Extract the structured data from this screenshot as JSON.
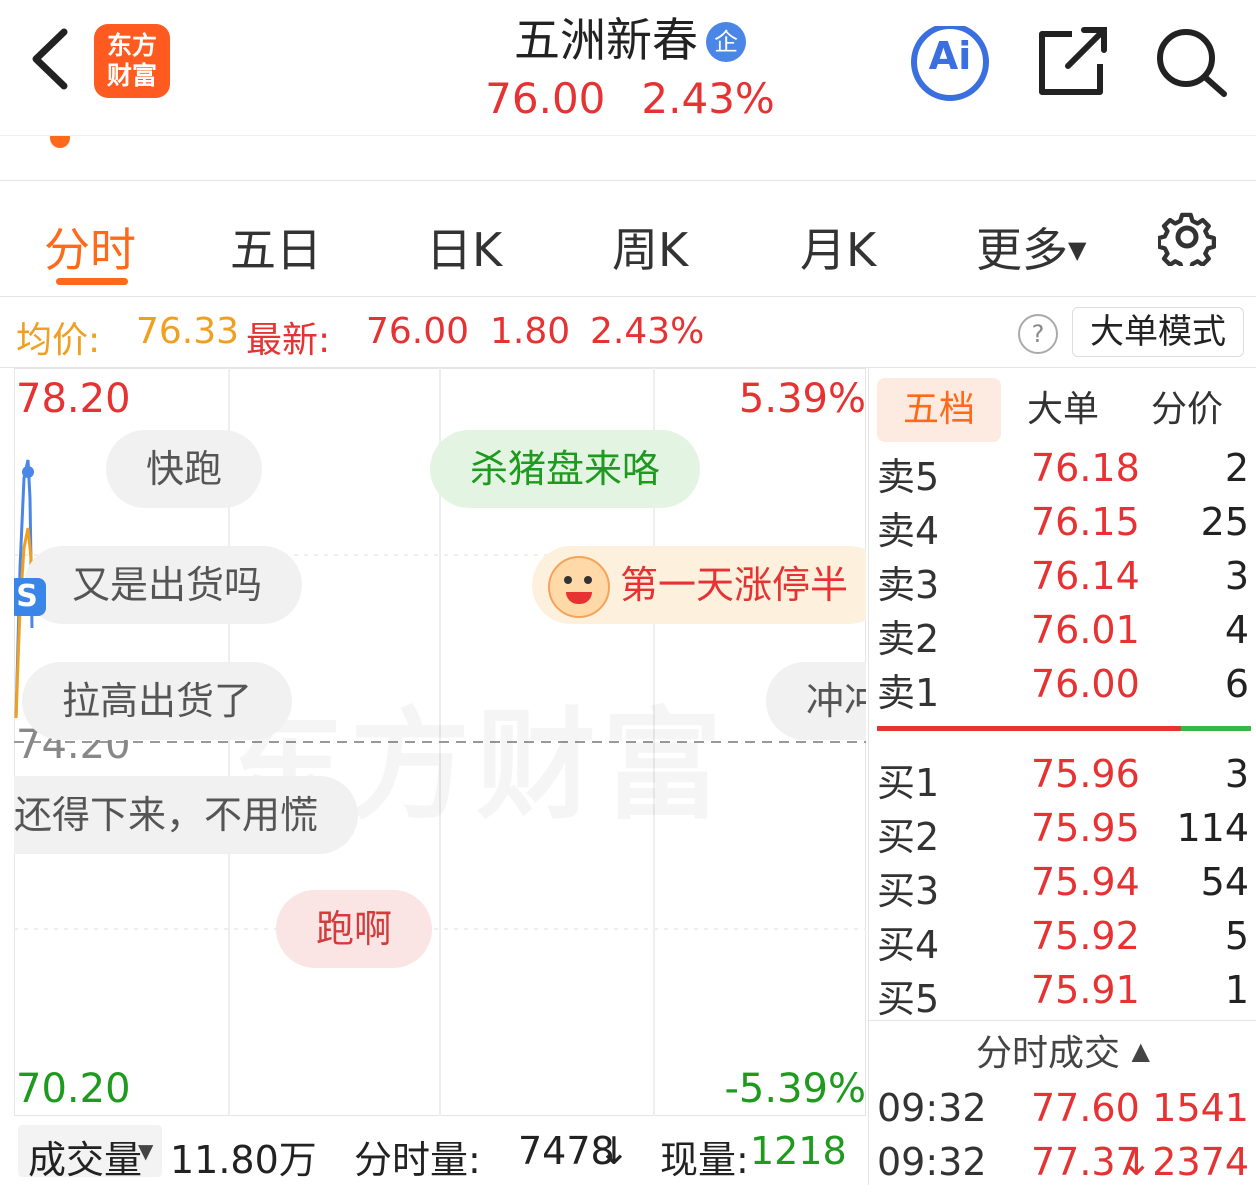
{
  "header": {
    "logo_line1": "东方",
    "logo_line2": "财富",
    "stock_name": "五洲新春",
    "badge": "企",
    "price": "76.00",
    "change_pct": "2.43%",
    "ai_label": "Ai"
  },
  "tabs": [
    "分时",
    "五日",
    "日K",
    "周K",
    "月K",
    "更多"
  ],
  "info": {
    "avg_label": "均价:",
    "avg_value": "76.33",
    "latest_label": "最新:",
    "latest_value": "76.00",
    "change": "1.80",
    "change_pct": "2.43%",
    "help": "?",
    "big_order_mode": "大单模式"
  },
  "chart": {
    "price_high": "78.20",
    "pct_high": "5.39%",
    "price_mid": "74.20",
    "price_low": "70.20",
    "pct_low": "-5.39%",
    "watermark": "东方财富"
  },
  "danmu": [
    {
      "text": "快跑"
    },
    {
      "text": "杀猪盘来咯"
    },
    {
      "text": "又是出货吗"
    },
    {
      "text": "第一天涨停半"
    },
    {
      "text": "拉高出货了"
    },
    {
      "text": "冲冲"
    },
    {
      "text": "还得下来，不用慌"
    },
    {
      "text": "跑啊"
    }
  ],
  "volume": {
    "selector": "成交量",
    "total": "11.80万",
    "minute_label": "分时量:",
    "minute_value": "7478",
    "current_label": "现量:",
    "current_value": "1218"
  },
  "book": {
    "tabs": [
      "五档",
      "大单",
      "分价"
    ],
    "asks": [
      {
        "label": "卖5",
        "price": "76.18",
        "qty": "2"
      },
      {
        "label": "卖4",
        "price": "76.15",
        "qty": "25"
      },
      {
        "label": "卖3",
        "price": "76.14",
        "qty": "3"
      },
      {
        "label": "卖2",
        "price": "76.01",
        "qty": "4"
      },
      {
        "label": "卖1",
        "price": "76.00",
        "qty": "6"
      }
    ],
    "bids": [
      {
        "label": "买1",
        "price": "75.96",
        "qty": "3"
      },
      {
        "label": "买2",
        "price": "75.95",
        "qty": "114"
      },
      {
        "label": "买3",
        "price": "75.94",
        "qty": "54"
      },
      {
        "label": "买4",
        "price": "75.92",
        "qty": "5"
      },
      {
        "label": "买5",
        "price": "75.91",
        "qty": "1"
      }
    ],
    "trades_header": "分时成交",
    "trades": [
      {
        "time": "09:32",
        "price": "77.60",
        "qty": "1541"
      },
      {
        "time": "09:32",
        "price": "77.37",
        "qty": "↓2374"
      }
    ]
  },
  "colors": {
    "up": "#e63232",
    "down": "#1e9a1e",
    "accent": "#ff6a1a",
    "avg": "#f0a020"
  }
}
